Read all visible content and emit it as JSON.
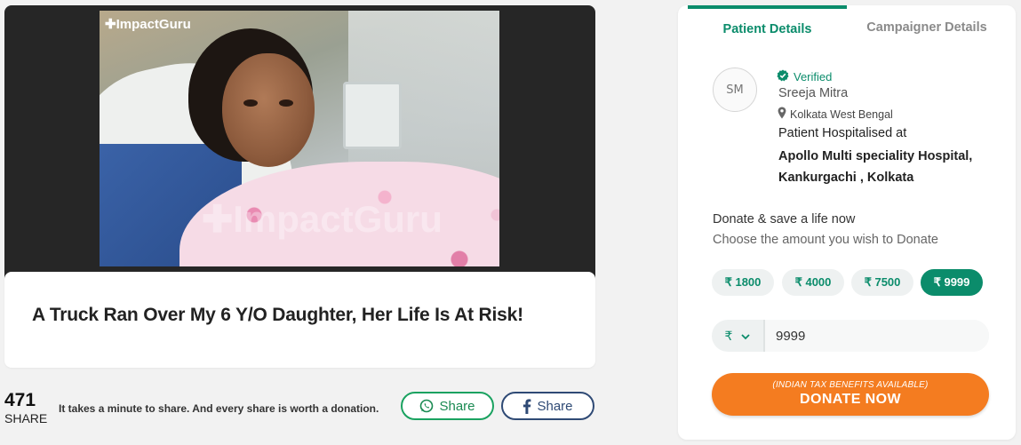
{
  "campaign": {
    "logo_text": "✚ImpactGuru",
    "watermark_text": "✚ImpactGuru",
    "title": "A Truck Ran Over My 6 Y/O Daughter, Her Life Is At Risk!"
  },
  "share": {
    "count": "471",
    "count_label": "SHARE",
    "prompt": "It takes a minute to share. And every share is worth a donation.",
    "whatsapp_label": "Share",
    "facebook_label": "Share",
    "whatsapp_color": "#1aa260",
    "facebook_color": "#2f4a75"
  },
  "panel": {
    "tabs": [
      {
        "label": "Patient Details",
        "active": true
      },
      {
        "label": "Campaigner Details",
        "active": false
      }
    ],
    "patient": {
      "initials": "SM",
      "verified_label": "Verified",
      "name": "Sreeja Mitra",
      "location": "Kolkata West Bengal",
      "hospital_label": "Patient Hospitalised at",
      "hospital_name": "Apollo Multi speciality Hospital, Kankurgachi , Kolkata"
    },
    "donate": {
      "heading": "Donate & save a life now",
      "subheading": "Choose the amount you wish to Donate",
      "amounts": [
        "₹ 1800",
        "₹ 4000",
        "₹ 7500",
        "₹ 9999"
      ],
      "selected_amount": "₹ 9999",
      "currency_symbol": "₹",
      "amount_value": "9999",
      "button_note": "(INDIAN TAX BENEFITS AVAILABLE)",
      "button_label": "DONATE NOW"
    },
    "colors": {
      "accent": "#0b8c6b",
      "donate_button": "#f47c20"
    }
  }
}
